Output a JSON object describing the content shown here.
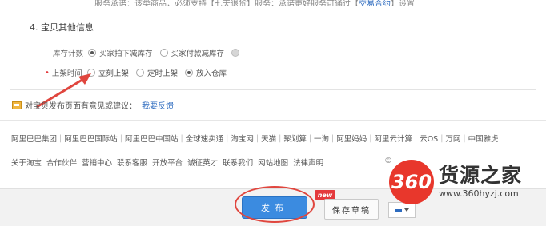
{
  "top_note": {
    "pre": "服务承诺：该类商品，必须支持【七天退货】服务；承诺更好服务可通过【",
    "link": "交易合约",
    "post": "】设置"
  },
  "section": {
    "title": "4. 宝贝其他信息"
  },
  "inventory": {
    "label": "库存计数",
    "options": [
      "买家拍下减库存",
      "买家付款减库存"
    ],
    "selected_index": 0
  },
  "listing_time": {
    "label": "上架时间",
    "options": [
      "立刻上架",
      "定时上架",
      "放入仓库"
    ],
    "selected_index": 2
  },
  "feedback": {
    "text": "对宝贝发布页面有意见或建议：",
    "link": "我要反馈"
  },
  "footer": {
    "links": [
      "阿里巴巴集团",
      "阿里巴巴国际站",
      "阿里巴巴中国站",
      "全球速卖通",
      "淘宝网",
      "天猫",
      "聚划算",
      "一淘",
      "阿里妈妈",
      "阿里云计算",
      "云OS",
      "万网",
      "中国雅虎"
    ],
    "links2": [
      "关于淘宝",
      "合作伙伴",
      "营销中心",
      "联系客服",
      "开放平台",
      "诚征英才",
      "联系我们",
      "网站地图",
      "法律声明"
    ],
    "copyright_mark": "©"
  },
  "actions": {
    "publish": "发布",
    "new_badge": "new",
    "save_draft": "保存草稿"
  },
  "watermark": {
    "logo": "360",
    "title": "货源之家",
    "url": "www.360hyzj.com"
  },
  "colors": {
    "primary_button": "#3b8be0",
    "annotation_red": "#e0463e",
    "link_blue": "#2d6bbf"
  }
}
